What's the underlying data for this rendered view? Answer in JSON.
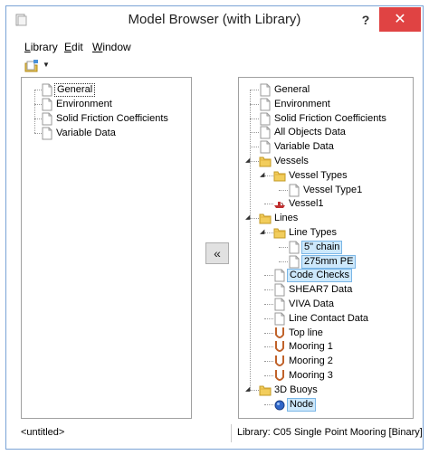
{
  "window": {
    "title": "Model Browser (with Library)",
    "help_label": "?",
    "close_label": "✕"
  },
  "menu": {
    "items": [
      "Library",
      "Edit",
      "Window"
    ]
  },
  "transfer_button": {
    "label": "«"
  },
  "left_tree": [
    {
      "label": "General",
      "selected": true
    },
    {
      "label": "Environment"
    },
    {
      "label": "Solid Friction Coefficients"
    },
    {
      "label": "Variable Data"
    }
  ],
  "right_tree": [
    {
      "label": "General",
      "icon": "page-icon",
      "level": 0
    },
    {
      "label": "Environment",
      "icon": "page-icon",
      "level": 0
    },
    {
      "label": "Solid Friction Coefficients",
      "icon": "page-icon",
      "level": 0
    },
    {
      "label": "All Objects Data",
      "icon": "page-icon",
      "level": 0
    },
    {
      "label": "Variable Data",
      "icon": "page-icon",
      "level": 0
    },
    {
      "label": "Vessels",
      "icon": "folder-icon",
      "level": 0,
      "expanded": true
    },
    {
      "label": "Vessel Types",
      "icon": "folder-icon",
      "level": 1,
      "expanded": true
    },
    {
      "label": "Vessel Type1",
      "icon": "page-icon",
      "level": 2
    },
    {
      "label": "Vessel1",
      "icon": "vessel-icon",
      "level": 1
    },
    {
      "label": "Lines",
      "icon": "folder-icon",
      "level": 0,
      "expanded": true
    },
    {
      "label": "Line Types",
      "icon": "folder-icon",
      "level": 1,
      "expanded": true
    },
    {
      "label": "5\" chain",
      "icon": "page-icon",
      "level": 2,
      "highlighted": true
    },
    {
      "label": "275mm PE",
      "icon": "page-icon",
      "level": 2,
      "highlighted": true
    },
    {
      "label": "Code Checks",
      "icon": "page-icon",
      "level": 1,
      "highlighted": true
    },
    {
      "label": "SHEAR7 Data",
      "icon": "page-icon",
      "level": 1
    },
    {
      "label": "VIVA Data",
      "icon": "page-icon",
      "level": 1
    },
    {
      "label": "Line Contact Data",
      "icon": "page-icon",
      "level": 1
    },
    {
      "label": "Top line",
      "icon": "line-icon",
      "level": 1
    },
    {
      "label": "Mooring 1",
      "icon": "line-icon",
      "level": 1
    },
    {
      "label": "Mooring 2",
      "icon": "line-icon",
      "level": 1
    },
    {
      "label": "Mooring 3",
      "icon": "line-icon",
      "level": 1
    },
    {
      "label": "3D Buoys",
      "icon": "folder-icon",
      "level": 0,
      "expanded": true
    },
    {
      "label": "Node",
      "icon": "buoy-icon",
      "level": 1,
      "highlighted": true
    }
  ],
  "status": {
    "left": "<untitled>",
    "right": "Library: C05 Single Point Mooring [Binary]"
  }
}
